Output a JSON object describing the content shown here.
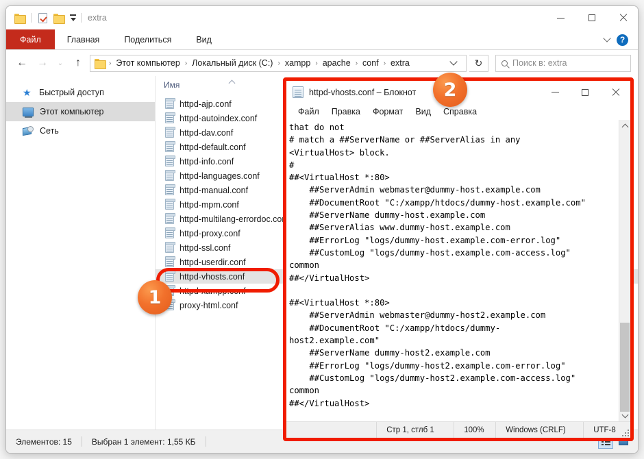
{
  "explorer": {
    "window_title": "extra",
    "quick_access": {
      "folder_icon": "folder-icon",
      "properties_icon": "properties-icon",
      "new_folder_icon": "new-folder-icon",
      "dropdown_icon": "chevron-down-icon"
    },
    "window_controls": {
      "minimize": "minimize-icon",
      "maximize": "maximize-icon",
      "close": "close-icon"
    },
    "ribbon": {
      "file_tab": "Файл",
      "tabs": [
        "Главная",
        "Поделиться",
        "Вид"
      ],
      "collapse_icon": "chevron-up-icon",
      "help_icon": "?"
    },
    "address": {
      "back_icon": "arrow-left-icon",
      "forward_icon": "arrow-right-icon",
      "recent_icon": "chevron-down-icon",
      "up_icon": "arrow-up-icon",
      "crumbs": [
        "Этот компьютер",
        "Локальный диск (C:)",
        "xampp",
        "apache",
        "conf",
        "extra"
      ],
      "separator": "›",
      "dropdown_icon": "chevron-down-icon",
      "refresh_icon": "↻"
    },
    "search": {
      "placeholder": "Поиск в: extra",
      "icon": "search-icon"
    },
    "navpane": {
      "items": [
        {
          "label": "Быстрый доступ",
          "icon": "star-icon",
          "selected": false
        },
        {
          "label": "Этот компьютер",
          "icon": "computer-icon",
          "selected": true
        },
        {
          "label": "Сеть",
          "icon": "network-icon",
          "selected": false
        }
      ]
    },
    "filelist": {
      "column_header": "Имя",
      "sort_icon": "sort-ascending-icon",
      "files": [
        {
          "name": "httpd-ajp.conf",
          "selected": false
        },
        {
          "name": "httpd-autoindex.conf",
          "selected": false
        },
        {
          "name": "httpd-dav.conf",
          "selected": false
        },
        {
          "name": "httpd-default.conf",
          "selected": false
        },
        {
          "name": "httpd-info.conf",
          "selected": false
        },
        {
          "name": "httpd-languages.conf",
          "selected": false
        },
        {
          "name": "httpd-manual.conf",
          "selected": false
        },
        {
          "name": "httpd-mpm.conf",
          "selected": false
        },
        {
          "name": "httpd-multilang-errordoc.conf",
          "selected": false
        },
        {
          "name": "httpd-proxy.conf",
          "selected": false
        },
        {
          "name": "httpd-ssl.conf",
          "selected": false
        },
        {
          "name": "httpd-userdir.conf",
          "selected": false
        },
        {
          "name": "httpd-vhosts.conf",
          "selected": true
        },
        {
          "name": "httpd-xampp.conf",
          "selected": false
        },
        {
          "name": "proxy-html.conf",
          "selected": false
        }
      ]
    },
    "statusbar": {
      "items_count": "Элементов: 15",
      "selection": "Выбран 1 элемент: 1,55 КБ",
      "details_view_icon": "details-view-icon",
      "tiles_view_icon": "tiles-view-icon"
    }
  },
  "notepad": {
    "title": "httpd-vhosts.conf – Блокнот",
    "title_icon": "notepad-icon",
    "window_controls": {
      "minimize": "minimize-icon",
      "maximize": "maximize-icon",
      "close": "close-icon"
    },
    "menu": [
      "Файл",
      "Правка",
      "Формат",
      "Вид",
      "Справка"
    ],
    "text": "that do not\n# match a ##ServerName or ##ServerAlias in any\n<VirtualHost> block.\n#\n##<VirtualHost *:80>\n    ##ServerAdmin webmaster@dummy-host.example.com\n    ##DocumentRoot \"C:/xampp/htdocs/dummy-host.example.com\"\n    ##ServerName dummy-host.example.com\n    ##ServerAlias www.dummy-host.example.com\n    ##ErrorLog \"logs/dummy-host.example.com-error.log\"\n    ##CustomLog \"logs/dummy-host.example.com-access.log\"\ncommon\n##</VirtualHost>\n\n##<VirtualHost *:80>\n    ##ServerAdmin webmaster@dummy-host2.example.com\n    ##DocumentRoot \"C:/xampp/htdocs/dummy-\nhost2.example.com\"\n    ##ServerName dummy-host2.example.com\n    ##ErrorLog \"logs/dummy-host2.example.com-error.log\"\n    ##CustomLog \"logs/dummy-host2.example.com-access.log\"\ncommon\n##</VirtualHost>",
    "scrollbar": {
      "up_icon": "scroll-up-icon",
      "down_icon": "scroll-down-icon"
    },
    "statusbar": {
      "position": "Стр 1, стлб 1",
      "zoom": "100%",
      "line_ending": "Windows (CRLF)",
      "encoding": "UTF-8"
    }
  },
  "annotations": {
    "highlight_color": "#f01c00",
    "badges": [
      {
        "number": "1"
      },
      {
        "number": "2"
      }
    ]
  }
}
